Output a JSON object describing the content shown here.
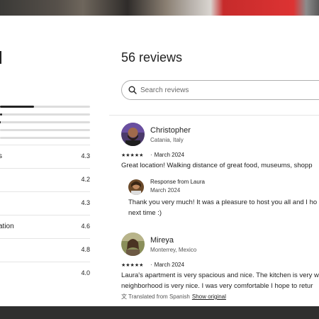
{
  "left_panel": {
    "categories": [
      {
        "label": "s",
        "score": "4.3"
      },
      {
        "label": "",
        "score": "4.2"
      },
      {
        "label": "",
        "score": "4.3"
      },
      {
        "label": "ation",
        "score": "4.6"
      },
      {
        "label": "",
        "score": "4.8"
      },
      {
        "label": "",
        "score": "4.0"
      }
    ],
    "rating_bars": [
      0.38,
      0.02,
      0.01,
      0.0,
      0.0
    ]
  },
  "reviews_header": {
    "title": "56 reviews",
    "search_placeholder": "Search reviews"
  },
  "reviews": [
    {
      "name": "Christopher",
      "location": "Catania, Italy",
      "stars": "★★★★★",
      "date": "March 2024",
      "text": "Great location! Walking distance of great food, museums, shopp",
      "response": {
        "name": "Response from Laura",
        "date": "March 2024",
        "text_line1": "Thank you very much! It was a pleasure to host you all and I ho",
        "text_line2": "next time :)"
      },
      "avatar_icon": "person-avatar-icon"
    },
    {
      "name": "Mireya",
      "location": "Monterrey, Mexico",
      "stars": "★★★★★",
      "date": "March 2024",
      "text_line1": "Laura's apartment is very spacious and nice. The kitchen is very w",
      "text_line2": "neighborhood is very nice. I was very comfortable I hope to retur",
      "translated_note": "Translated from Spanish",
      "show_original": "Show original",
      "avatar_icon": "person-avatar-icon"
    }
  ],
  "colors": {
    "text": "#222222",
    "divider": "#e5e5e5",
    "bar_track": "#dddddd"
  }
}
